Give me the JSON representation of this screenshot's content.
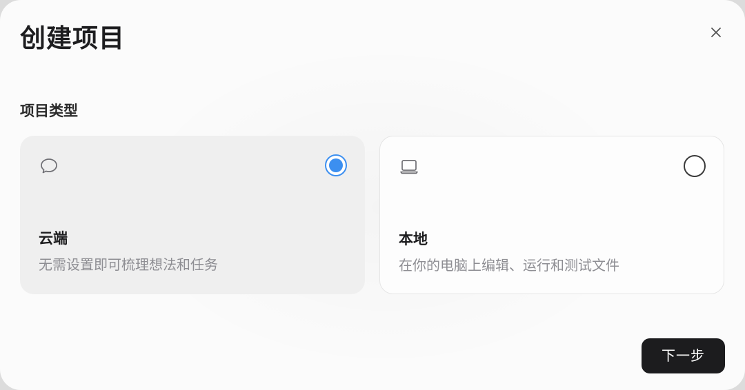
{
  "dialog": {
    "title": "创建项目",
    "close_icon": "close-icon"
  },
  "project_type": {
    "label": "项目类型",
    "options": [
      {
        "icon": "chat-bubble-icon",
        "title": "云端",
        "description": "无需设置即可梳理想法和任务",
        "selected": true
      },
      {
        "icon": "laptop-icon",
        "title": "本地",
        "description": "在你的电脑上编辑、运行和测试文件",
        "selected": false
      }
    ]
  },
  "footer": {
    "next_label": "下一步"
  },
  "colors": {
    "accent": "#3c8ff0",
    "primary_button": "#1c1c1e",
    "selected_card": "#efefef"
  }
}
